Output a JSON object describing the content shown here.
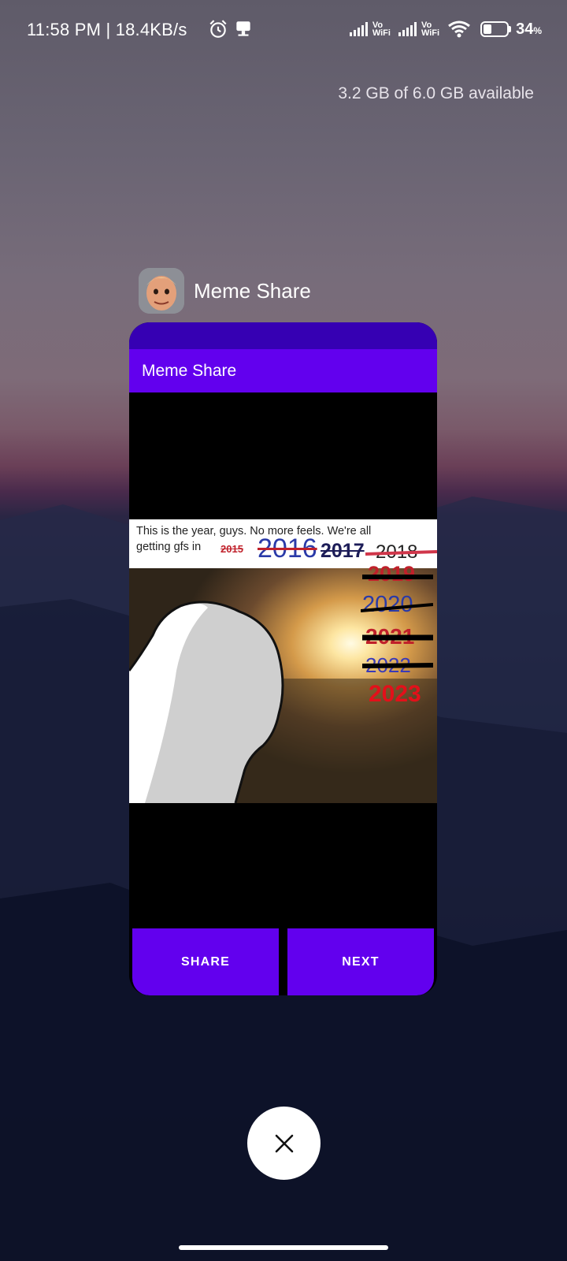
{
  "status_bar": {
    "time": "11:58 PM",
    "speed": "18.4KB/s",
    "vo_label": "Vo",
    "wifi_label": "WiFi",
    "battery_percent": "34",
    "battery_percent_sign": "%",
    "battery_level": 0.34,
    "icons": [
      "alarm-icon",
      "notification-icon",
      "signal-icon",
      "vowifi-icon",
      "signal-icon",
      "vowifi-icon",
      "wifi-icon",
      "battery-icon"
    ]
  },
  "memory_info": "3.2 GB of 6.0 GB available",
  "recent_app": {
    "name": "Meme Share",
    "toolbar_title": "Meme Share",
    "meme": {
      "caption_line1": "This is the year, guys. No more feels. We're all",
      "caption_line2": "getting gfs in",
      "years": [
        "2015",
        "2016",
        "2017",
        "2018",
        "2019",
        "2020",
        "2021",
        "2022",
        "2023"
      ]
    },
    "share_label": "SHARE",
    "next_label": "NEXT"
  },
  "colors": {
    "primary": "#6200ee",
    "primary_dark": "#3600b3"
  }
}
